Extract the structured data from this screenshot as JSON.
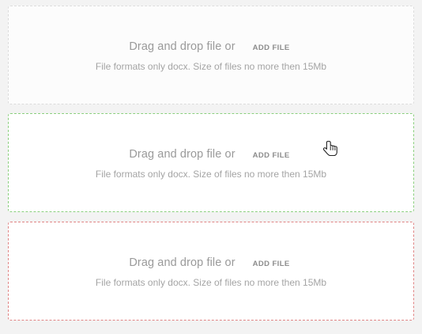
{
  "colors": {
    "default_border": "#dcdcdc",
    "hover_border": "#8bcf7e",
    "error_border": "#e08585"
  },
  "dropzones": [
    {
      "state": "default",
      "prompt": "Drag and drop file or",
      "action_label": "ADD FILE",
      "hint": "File formats only docx. Size of files no more then 15Mb"
    },
    {
      "state": "hover",
      "prompt": "Drag and drop file or",
      "action_label": "ADD FILE",
      "hint": "File formats only docx. Size of files no more then 15Mb"
    },
    {
      "state": "error",
      "prompt": "Drag and drop file or",
      "action_label": "ADD FILE",
      "hint": "File formats only docx. Size of files no more then 15Mb"
    }
  ],
  "cursor_icon": "hand-pointer-icon"
}
